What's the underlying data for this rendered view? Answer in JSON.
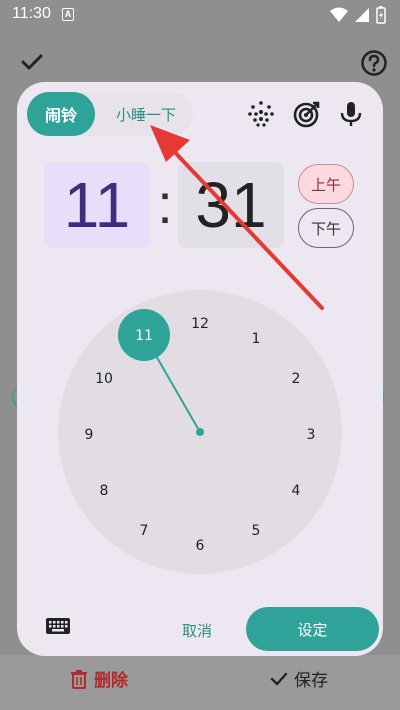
{
  "status_bar": {
    "time": "11:30",
    "notification_badge": "A"
  },
  "dialog": {
    "tabs": [
      {
        "label": "闹铃",
        "selected": true
      },
      {
        "label": "小睡一下",
        "selected": false
      }
    ],
    "header_icons": [
      "sunrise-dots-icon",
      "target-icon",
      "microphone-icon"
    ],
    "hour": "11",
    "colon": ":",
    "minute": "31",
    "am_label": "上午",
    "pm_label": "下午",
    "selected_period": "上午",
    "clock": {
      "selected_hour": "11",
      "numbers": [
        "12",
        "1",
        "2",
        "3",
        "4",
        "5",
        "6",
        "7",
        "8",
        "9",
        "10"
      ]
    },
    "cancel_label": "取消",
    "ok_label": "设定"
  },
  "bottom_bar": {
    "delete_label": "删除",
    "save_label": "保存"
  },
  "colors": {
    "accent": "#2fa39a",
    "arrow": "#e53935",
    "hour_box": "#e9defa",
    "am_pill": "#fbd9df",
    "delete": "#b22a2a"
  }
}
